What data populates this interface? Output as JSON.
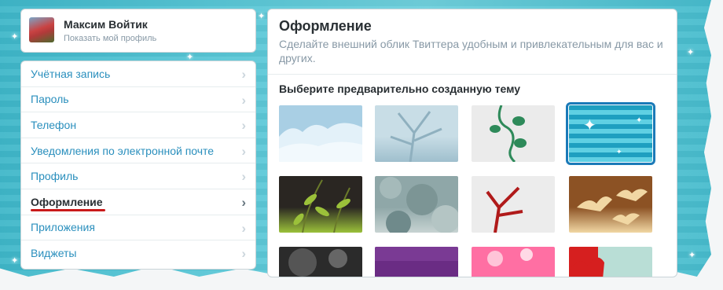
{
  "profile": {
    "name": "Максим Войтик",
    "link": "Показать мой профиль"
  },
  "nav": {
    "items": [
      {
        "label": "Учётная запись",
        "name": "nav-account"
      },
      {
        "label": "Пароль",
        "name": "nav-password"
      },
      {
        "label": "Телефон",
        "name": "nav-phone"
      },
      {
        "label": "Уведомления по электронной почте",
        "name": "nav-email-notifications"
      },
      {
        "label": "Профиль",
        "name": "nav-profile"
      },
      {
        "label": "Оформление",
        "name": "nav-design",
        "active": true
      },
      {
        "label": "Приложения",
        "name": "nav-apps"
      },
      {
        "label": "Виджеты",
        "name": "nav-widgets"
      }
    ],
    "chevron": "›"
  },
  "main": {
    "title": "Оформление",
    "subtitle": "Сделайте внешний облик Твиттера удобным и привлекательным для вас и других.",
    "section_title": "Выберите предварительно созданную тему"
  },
  "themes": [
    {
      "name": "theme-clouds",
      "colors": [
        "#a9cfe4",
        "#d6ebf6"
      ]
    },
    {
      "name": "theme-tree",
      "colors": [
        "#c8dde6",
        "#9fbfcd"
      ]
    },
    {
      "name": "theme-vines",
      "colors": [
        "#ebebeb",
        "#2e8a5a"
      ]
    },
    {
      "name": "theme-sparkle",
      "colors": [
        "#1e9fc0",
        "#5fd0e3"
      ],
      "selected": true
    },
    {
      "name": "theme-leaves",
      "colors": [
        "#2a2622",
        "#9bc13a"
      ]
    },
    {
      "name": "theme-grey-foliage",
      "colors": [
        "#8fa7a8",
        "#c7d3d2"
      ]
    },
    {
      "name": "theme-red-plant",
      "colors": [
        "#ececec",
        "#b01a1a"
      ]
    },
    {
      "name": "theme-birds",
      "colors": [
        "#8c5224",
        "#f1d7a3"
      ]
    },
    {
      "name": "theme-dark",
      "colors": [
        "#2b2b2b",
        "#7e7e7e"
      ]
    },
    {
      "name": "theme-purple",
      "colors": [
        "#6a2c84",
        "#a65fc4"
      ]
    },
    {
      "name": "theme-pink",
      "colors": [
        "#ff6fa3",
        "#ffc4d8"
      ]
    },
    {
      "name": "theme-red-flower",
      "colors": [
        "#d61f1f",
        "#b9ded6"
      ]
    }
  ]
}
